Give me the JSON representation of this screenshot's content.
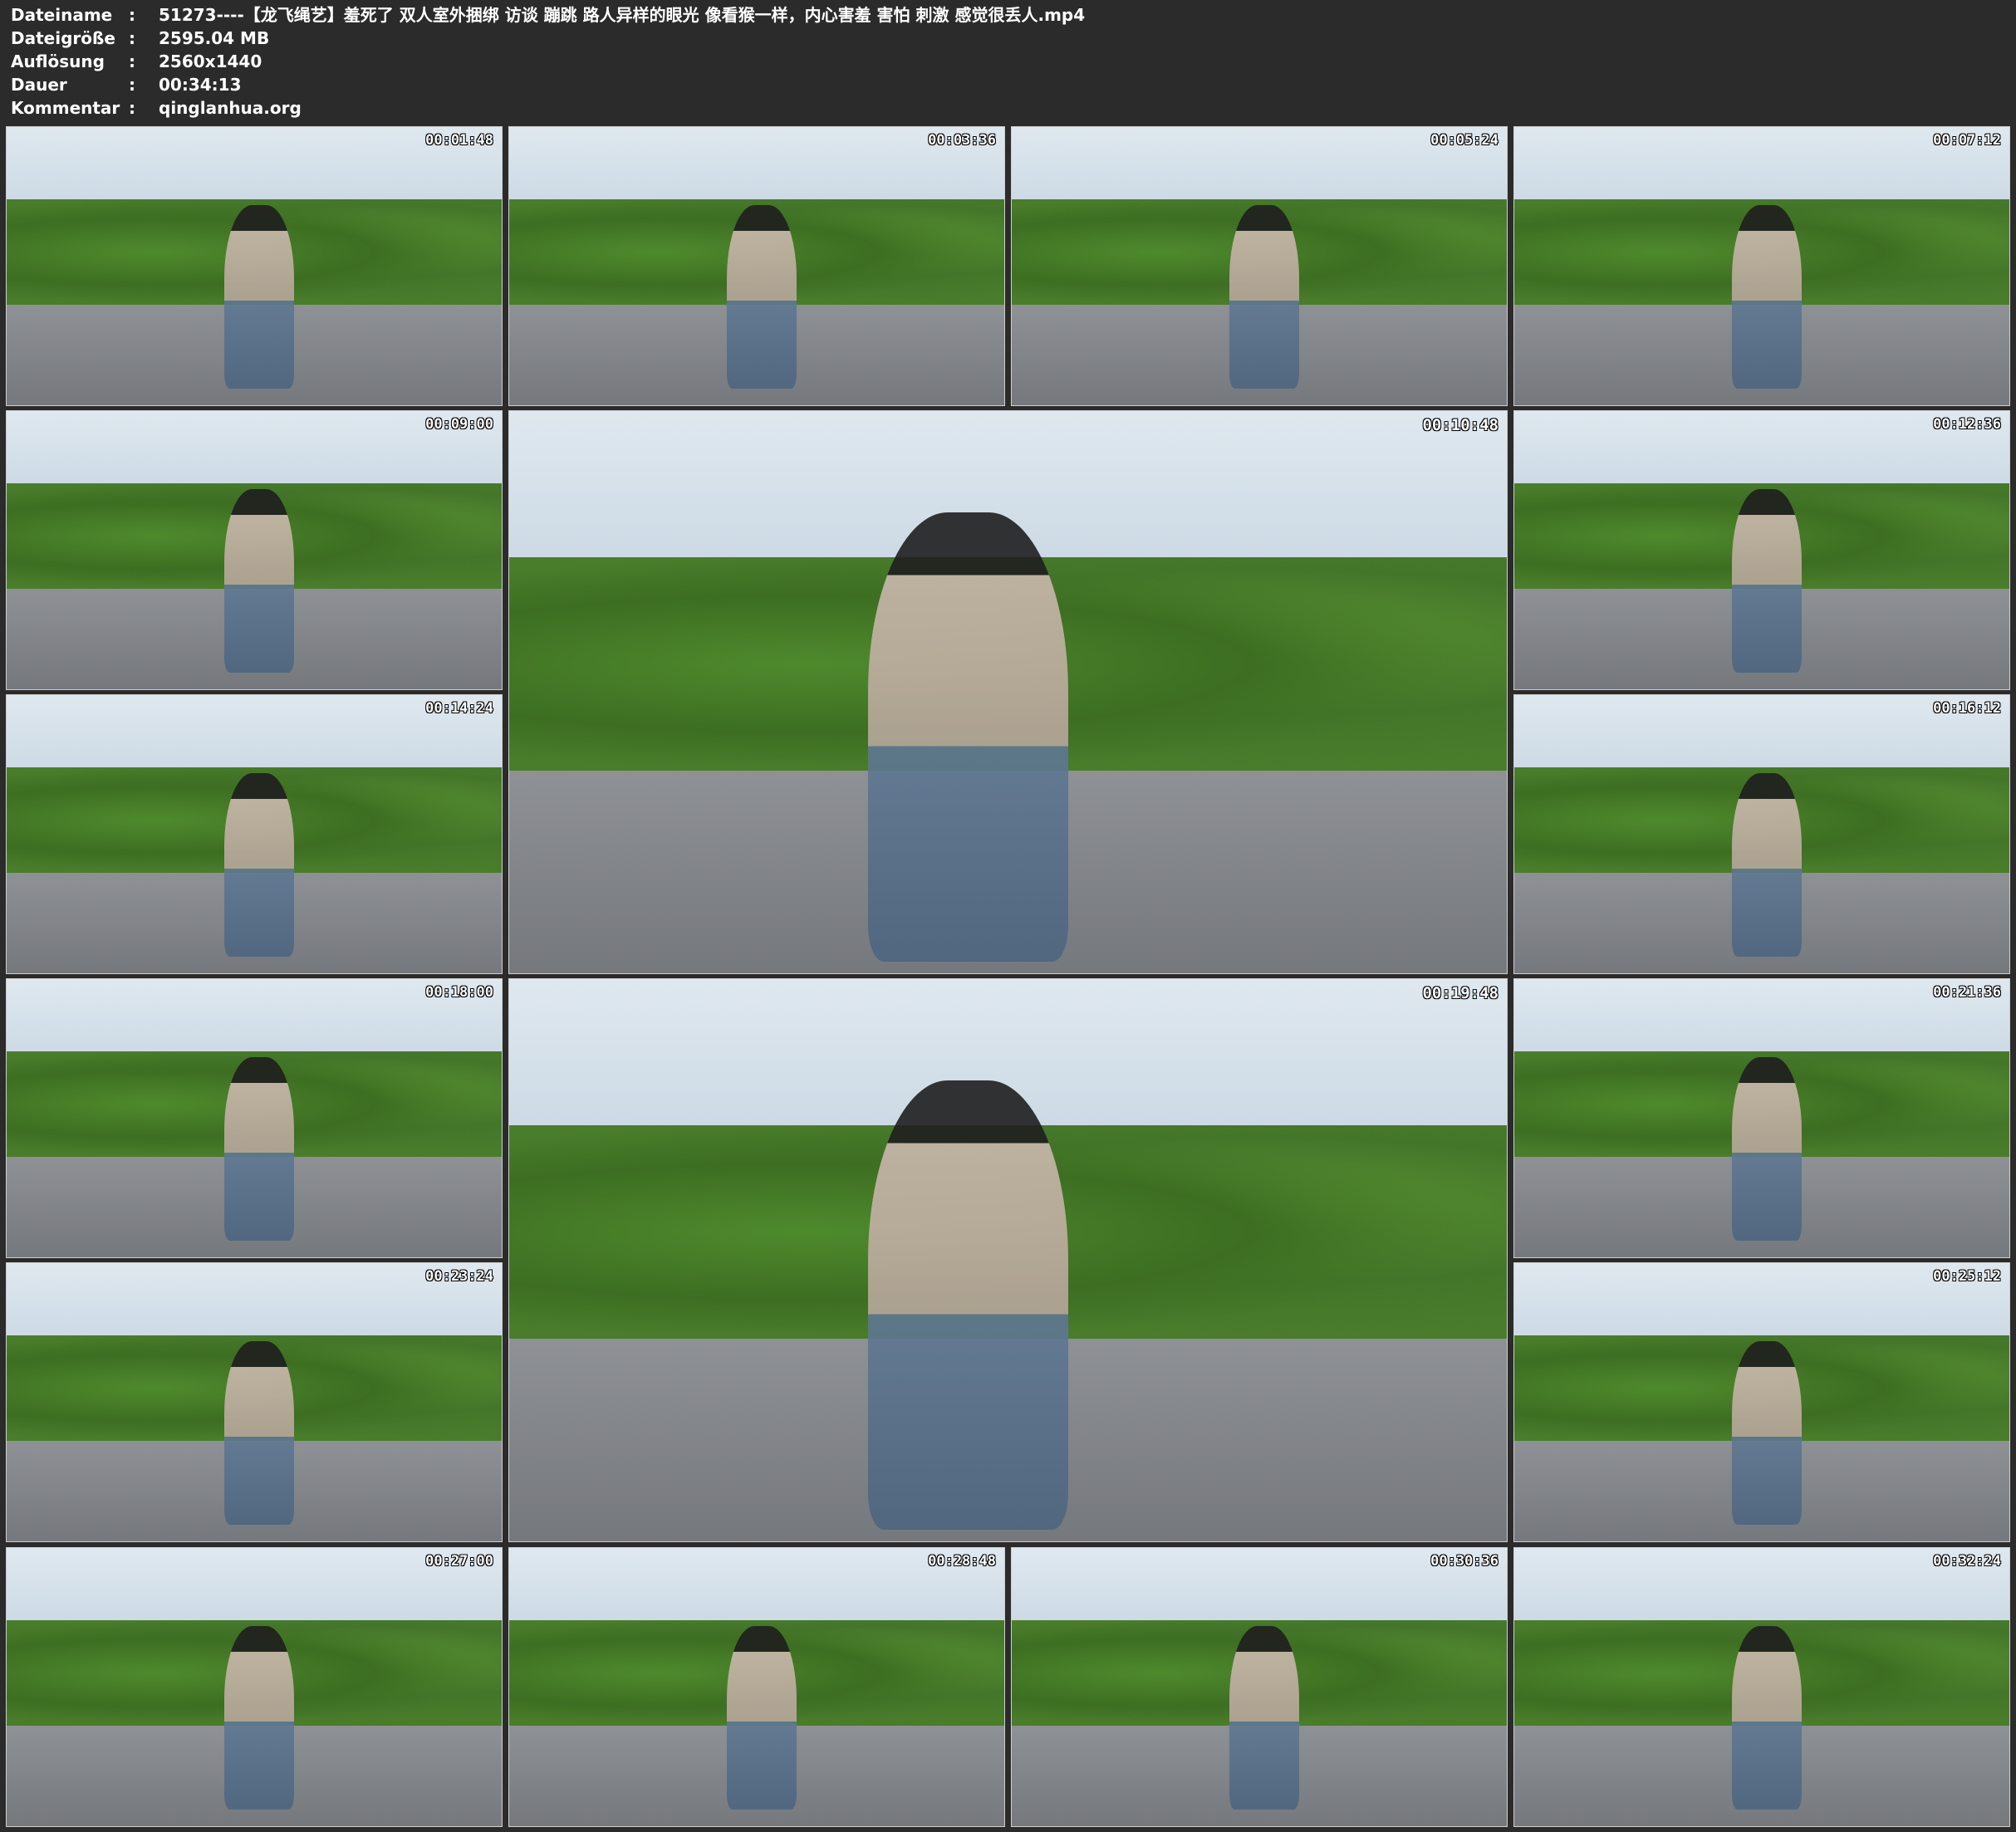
{
  "header": {
    "rows": [
      {
        "key": "Dateiname",
        "sep": ":",
        "value": "51273----【龙飞绳艺】羞死了 双人室外捆绑 访谈 蹦跳 路人异样的眼光 像看猴一样，内心害羞 害怕 刺激 感觉很丢人.mp4"
      },
      {
        "key": "Dateigröße",
        "sep": ":",
        "value": "2595.04 MB"
      },
      {
        "key": "Auflösung",
        "sep": ":",
        "value": "2560x1440"
      },
      {
        "key": "Dauer",
        "sep": ":",
        "value": "00:34:13"
      },
      {
        "key": "Kommentar",
        "sep": ":",
        "value": "qinglanhua.org"
      }
    ]
  },
  "thumbnails": [
    {
      "timestamp": "00:01:48"
    },
    {
      "timestamp": "00:03:36"
    },
    {
      "timestamp": "00:05:24"
    },
    {
      "timestamp": "00:07:12"
    },
    {
      "timestamp": "00:09:00"
    },
    {
      "timestamp": "00:10:48"
    },
    {
      "timestamp": "00:12:36"
    },
    {
      "timestamp": "00:14:24"
    },
    {
      "timestamp": "00:16:12"
    },
    {
      "timestamp": "00:18:00"
    },
    {
      "timestamp": "00:19:48"
    },
    {
      "timestamp": "00:21:36"
    },
    {
      "timestamp": "00:23:24"
    },
    {
      "timestamp": "00:25:12"
    },
    {
      "timestamp": "00:27:00"
    },
    {
      "timestamp": "00:28:48"
    },
    {
      "timestamp": "00:30:36"
    },
    {
      "timestamp": "00:32:24"
    }
  ]
}
